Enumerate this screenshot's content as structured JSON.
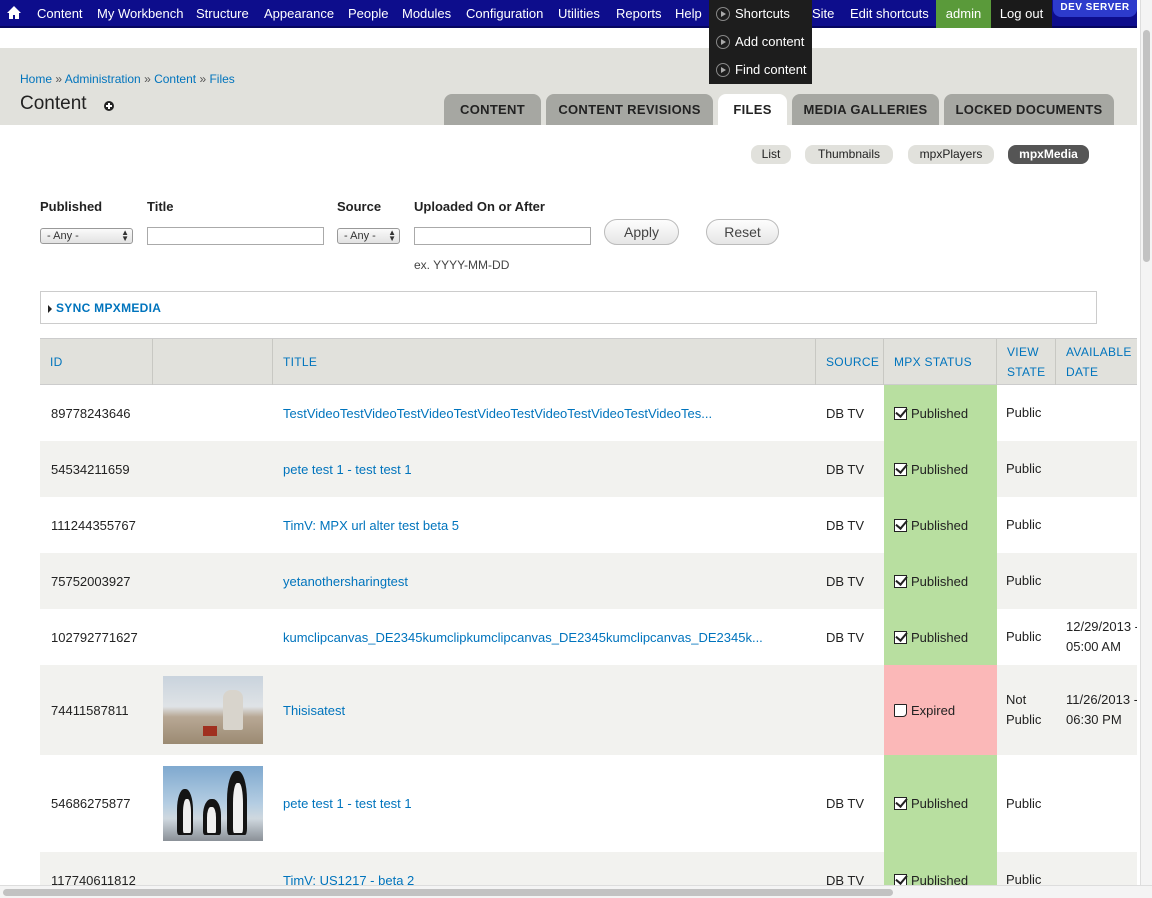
{
  "toolbar": {
    "items": [
      "Content",
      "My Workbench",
      "Structure",
      "Appearance",
      "People",
      "Modules",
      "Configuration",
      "Utilities",
      "Reports",
      "Help"
    ],
    "shortcuts_label": "Shortcuts",
    "site_partial": "Site",
    "edit_shortcuts": "Edit shortcuts",
    "user": "admin",
    "logout": "Log out",
    "env_badge": "DEV SERVER"
  },
  "shortcuts_menu": [
    "Add content",
    "Find content"
  ],
  "breadcrumb": [
    "Home",
    "Administration",
    "Content",
    "Files"
  ],
  "page_title": "Content",
  "tabs": [
    {
      "label": "CONTENT",
      "active": false
    },
    {
      "label": "CONTENT REVISIONS",
      "active": false
    },
    {
      "label": "FILES",
      "active": true
    },
    {
      "label": "MEDIA GALLERIES",
      "active": false
    },
    {
      "label": "LOCKED DOCUMENTS",
      "active": false
    }
  ],
  "view_pills": [
    {
      "label": "List",
      "active": false
    },
    {
      "label": "Thumbnails",
      "active": false
    },
    {
      "label": "mpxPlayers",
      "active": false
    },
    {
      "label": "mpxMedia",
      "active": true
    }
  ],
  "filters": {
    "published_label": "Published",
    "published_value": "- Any -",
    "title_label": "Title",
    "title_value": "",
    "source_label": "Source",
    "source_value": "- Any -",
    "uploaded_label": "Uploaded On or After",
    "uploaded_value": "",
    "uploaded_hint": "ex. YYYY-MM-DD",
    "apply": "Apply",
    "reset": "Reset"
  },
  "sync_section": "SYNC MPXMEDIA",
  "table": {
    "headers": [
      "ID",
      "",
      "TITLE",
      "SOURCE",
      "MPX STATUS",
      "VIEW STATE",
      "AVAILABLE DATE"
    ],
    "rows": [
      {
        "id": "89778243646",
        "thumb": "",
        "title": "TestVideoTestVideoTestVideoTestVideoTestVideoTestVideoTestVideoTes...",
        "source": "DB TV",
        "status": "Published",
        "view": "Public",
        "available": ""
      },
      {
        "id": "54534211659",
        "thumb": "",
        "title": "pete test 1 - test test 1",
        "source": "DB TV",
        "status": "Published",
        "view": "Public",
        "available": ""
      },
      {
        "id": "111244355767",
        "thumb": "",
        "title": "TimV: MPX url alter test beta 5",
        "source": "DB TV",
        "status": "Published",
        "view": "Public",
        "available": ""
      },
      {
        "id": "75752003927",
        "thumb": "",
        "title": "yetanothersharingtest",
        "source": "DB TV",
        "status": "Published",
        "view": "Public",
        "available": ""
      },
      {
        "id": "102792771627",
        "thumb": "",
        "title": "kumclipcanvas_DE2345kumclipkumclipcanvas_DE2345kumclipcanvas_DE2345k...",
        "source": "DB TV",
        "status": "Published",
        "view": "Public",
        "available": "12/29/2013 - 05:00 AM"
      },
      {
        "id": "74411587811",
        "thumb": "farmer",
        "title": "Thisisatest",
        "source": "",
        "status": "Expired",
        "view": "Not Public",
        "available": "11/26/2013 - 06:30 PM"
      },
      {
        "id": "54686275877",
        "thumb": "penguins",
        "title": "pete test 1 - test test 1",
        "source": "DB TV",
        "status": "Published",
        "view": "Public",
        "available": ""
      },
      {
        "id": "117740611812",
        "thumb": "",
        "title": "TimV: US1217 - beta 2",
        "source": "DB TV",
        "status": "Published",
        "view": "Public",
        "available": ""
      }
    ]
  },
  "colors": {
    "toolbar_bg": "#0d0d8c",
    "link": "#0074bd",
    "published_bg": "#b8dfa0",
    "expired_bg": "#fbb8b8",
    "admin_bg": "#5a9a3a"
  }
}
